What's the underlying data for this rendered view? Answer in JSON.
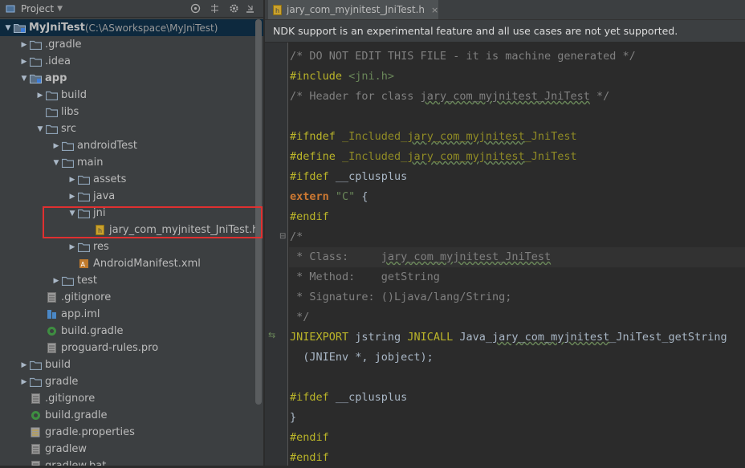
{
  "project_panel": {
    "title": "Project",
    "tree": [
      {
        "label": "MyJniTest",
        "suffix": " (C:\\ASworkspace\\MyJniTest)",
        "icon": "module-icon",
        "depth": 0,
        "expanded": true
      },
      {
        "label": ".gradle",
        "icon": "folder-icon",
        "depth": 1,
        "expanded": false
      },
      {
        "label": ".idea",
        "icon": "folder-icon",
        "depth": 1,
        "expanded": false
      },
      {
        "label": "app",
        "icon": "module-icon",
        "depth": 1,
        "expanded": true
      },
      {
        "label": "build",
        "icon": "folder-icon",
        "depth": 2,
        "expanded": false
      },
      {
        "label": "libs",
        "icon": "folder-icon",
        "depth": 2,
        "expanded": null
      },
      {
        "label": "src",
        "icon": "folder-icon",
        "depth": 2,
        "expanded": true
      },
      {
        "label": "androidTest",
        "icon": "folder-icon",
        "depth": 3,
        "expanded": false
      },
      {
        "label": "main",
        "icon": "folder-icon",
        "depth": 3,
        "expanded": true
      },
      {
        "label": "assets",
        "icon": "folder-icon",
        "depth": 4,
        "expanded": false
      },
      {
        "label": "java",
        "icon": "folder-icon",
        "depth": 4,
        "expanded": false
      },
      {
        "label": "jni",
        "icon": "folder-icon",
        "depth": 4,
        "expanded": true
      },
      {
        "label": "jary_com_myjnitest_JniTest.h",
        "icon": "header-file-icon",
        "depth": 5,
        "expanded": null
      },
      {
        "label": "res",
        "icon": "folder-icon",
        "depth": 4,
        "expanded": false
      },
      {
        "label": "AndroidManifest.xml",
        "icon": "xml-file-icon",
        "depth": 4,
        "expanded": null
      },
      {
        "label": "test",
        "icon": "folder-icon",
        "depth": 3,
        "expanded": false
      },
      {
        "label": ".gitignore",
        "icon": "text-file-icon",
        "depth": 2,
        "expanded": null
      },
      {
        "label": "app.iml",
        "icon": "iml-file-icon",
        "depth": 2,
        "expanded": null
      },
      {
        "label": "build.gradle",
        "icon": "gradle-file-icon",
        "depth": 2,
        "expanded": null
      },
      {
        "label": "proguard-rules.pro",
        "icon": "text-file-icon",
        "depth": 2,
        "expanded": null
      },
      {
        "label": "build",
        "icon": "folder-icon",
        "depth": 1,
        "expanded": false
      },
      {
        "label": "gradle",
        "icon": "folder-icon",
        "depth": 1,
        "expanded": false
      },
      {
        "label": ".gitignore",
        "icon": "text-file-icon",
        "depth": 1,
        "expanded": null
      },
      {
        "label": "build.gradle",
        "icon": "gradle-file-icon",
        "depth": 1,
        "expanded": null
      },
      {
        "label": "gradle.properties",
        "icon": "properties-file-icon",
        "depth": 1,
        "expanded": null
      },
      {
        "label": "gradlew",
        "icon": "text-file-icon",
        "depth": 1,
        "expanded": null
      },
      {
        "label": "gradlew.bat",
        "icon": "text-file-icon",
        "depth": 1,
        "expanded": null
      }
    ]
  },
  "editor": {
    "tab_label": "jary_com_myjnitest_JniTest.h",
    "notice": "NDK support is an experimental feature and all use cases are not yet supported.",
    "lines": [
      [
        {
          "t": "/* DO NOT EDIT THIS FILE - it is machine generated */",
          "c": "com"
        }
      ],
      [
        {
          "t": "#include ",
          "c": "pp"
        },
        {
          "t": "<jni.h>",
          "c": "str"
        }
      ],
      [
        {
          "t": "/* Header for class ",
          "c": "com"
        },
        {
          "t": "jary_com_myjnitest_JniTest",
          "c": "com",
          "sq": true
        },
        {
          "t": " */",
          "c": "com"
        }
      ],
      [],
      [
        {
          "t": "#ifndef ",
          "c": "pp"
        },
        {
          "t": "_Included_",
          "c": "mac"
        },
        {
          "t": "jary_com_myjnitest",
          "c": "mac",
          "sq": true
        },
        {
          "t": "_JniTest",
          "c": "mac"
        }
      ],
      [
        {
          "t": "#define ",
          "c": "pp"
        },
        {
          "t": "_Included_",
          "c": "mac"
        },
        {
          "t": "jary_com_myjnitest",
          "c": "mac",
          "sq": true
        },
        {
          "t": "_JniTest",
          "c": "mac"
        }
      ],
      [
        {
          "t": "#ifdef ",
          "c": "pp"
        },
        {
          "t": "__cplusplus",
          "c": "def"
        }
      ],
      [
        {
          "t": "extern ",
          "c": "kw"
        },
        {
          "t": "\"C\"",
          "c": "str"
        },
        {
          "t": " {",
          "c": "def"
        }
      ],
      [
        {
          "t": "#endif",
          "c": "pp"
        }
      ],
      [
        {
          "t": "/*",
          "c": "com"
        }
      ],
      [
        {
          "t": " * Class:     ",
          "c": "com"
        },
        {
          "t": "jary_com_myjnitest_JniTest",
          "c": "com",
          "sq": true
        }
      ],
      [
        {
          "t": " * Method:    getString",
          "c": "com"
        }
      ],
      [
        {
          "t": " * Signature: ()Ljava/lang/String;",
          "c": "com"
        }
      ],
      [
        {
          "t": " */",
          "c": "com"
        }
      ],
      [
        {
          "t": "JNIEXPORT ",
          "c": "pp"
        },
        {
          "t": "jstring ",
          "c": "def"
        },
        {
          "t": "JNICALL ",
          "c": "pp"
        },
        {
          "t": "Java_",
          "c": "def"
        },
        {
          "t": "jary_com_myjnitest",
          "c": "def",
          "sq": true
        },
        {
          "t": "_JniTest_getString",
          "c": "def"
        }
      ],
      [
        {
          "t": "  (JNIEnv *, jobject);",
          "c": "def"
        }
      ],
      [],
      [
        {
          "t": "#ifdef ",
          "c": "pp"
        },
        {
          "t": "__cplusplus",
          "c": "def"
        }
      ],
      [
        {
          "t": "}",
          "c": "def"
        }
      ],
      [
        {
          "t": "#endif",
          "c": "pp"
        }
      ],
      [
        {
          "t": "#endif",
          "c": "pp"
        }
      ]
    ],
    "current_line": 10
  },
  "colors": {
    "comment": "#808080",
    "preprocessor": "#bbb529",
    "keyword": "#cc7832",
    "string": "#6a8759",
    "highlight_box": "#e03030"
  }
}
